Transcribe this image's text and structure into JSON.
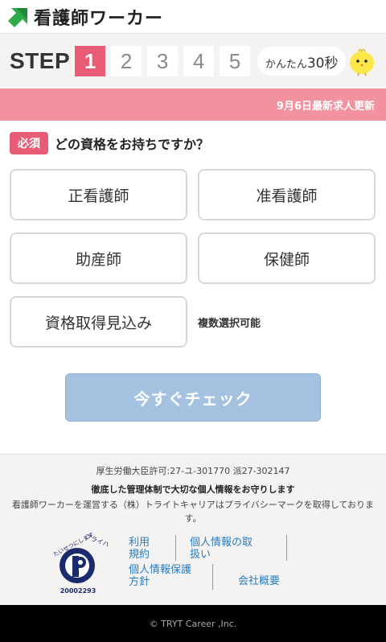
{
  "header": {
    "logo_text": "看護師ワーカー",
    "logo_icon": "green-arrow-logo-icon",
    "logo_color": "#2eaa4a"
  },
  "steps": {
    "label": "STEP",
    "numbers": [
      "1",
      "2",
      "3",
      "4",
      "5"
    ],
    "current": 1,
    "bubble_prefix": "かんたん",
    "bubble_time": "30秒",
    "mascot": "chick-icon",
    "active_color": "#e85c75"
  },
  "banner": {
    "text": "9月6日最新求人更新",
    "color": "#f2929e"
  },
  "question": {
    "badge": "必須",
    "text": "どの資格をお持ちですか？",
    "options": [
      "正看護師",
      "准看護師",
      "助産師",
      "保健師",
      "資格取得見込み"
    ],
    "multi_note": "複数選択可能"
  },
  "cta": {
    "label": "今すぐチェック",
    "color": "#a4c1e0"
  },
  "footer": {
    "license": "厚生労働大臣許可:27-ユ-301770 派27-302147",
    "privacy_title": "徹底した管理体制で大切な個人情報をお守りします",
    "privacy_desc": "看護師ワーカーを運営する（株）トライトキャリアはプライバシーマークを取得しております。",
    "pmark_text_top": "たいせつにします",
    "pmark_text_right": "プライバシー",
    "pmark_number": "20002293",
    "links": {
      "terms_1": "利用",
      "terms_2": "規約",
      "personal_1": "個人情報の取",
      "personal_2": "扱い",
      "policy_1": "個人情報保護",
      "policy_2": "方針",
      "company": "会社概要"
    }
  },
  "copyright": "© TRYT Career ,Inc."
}
